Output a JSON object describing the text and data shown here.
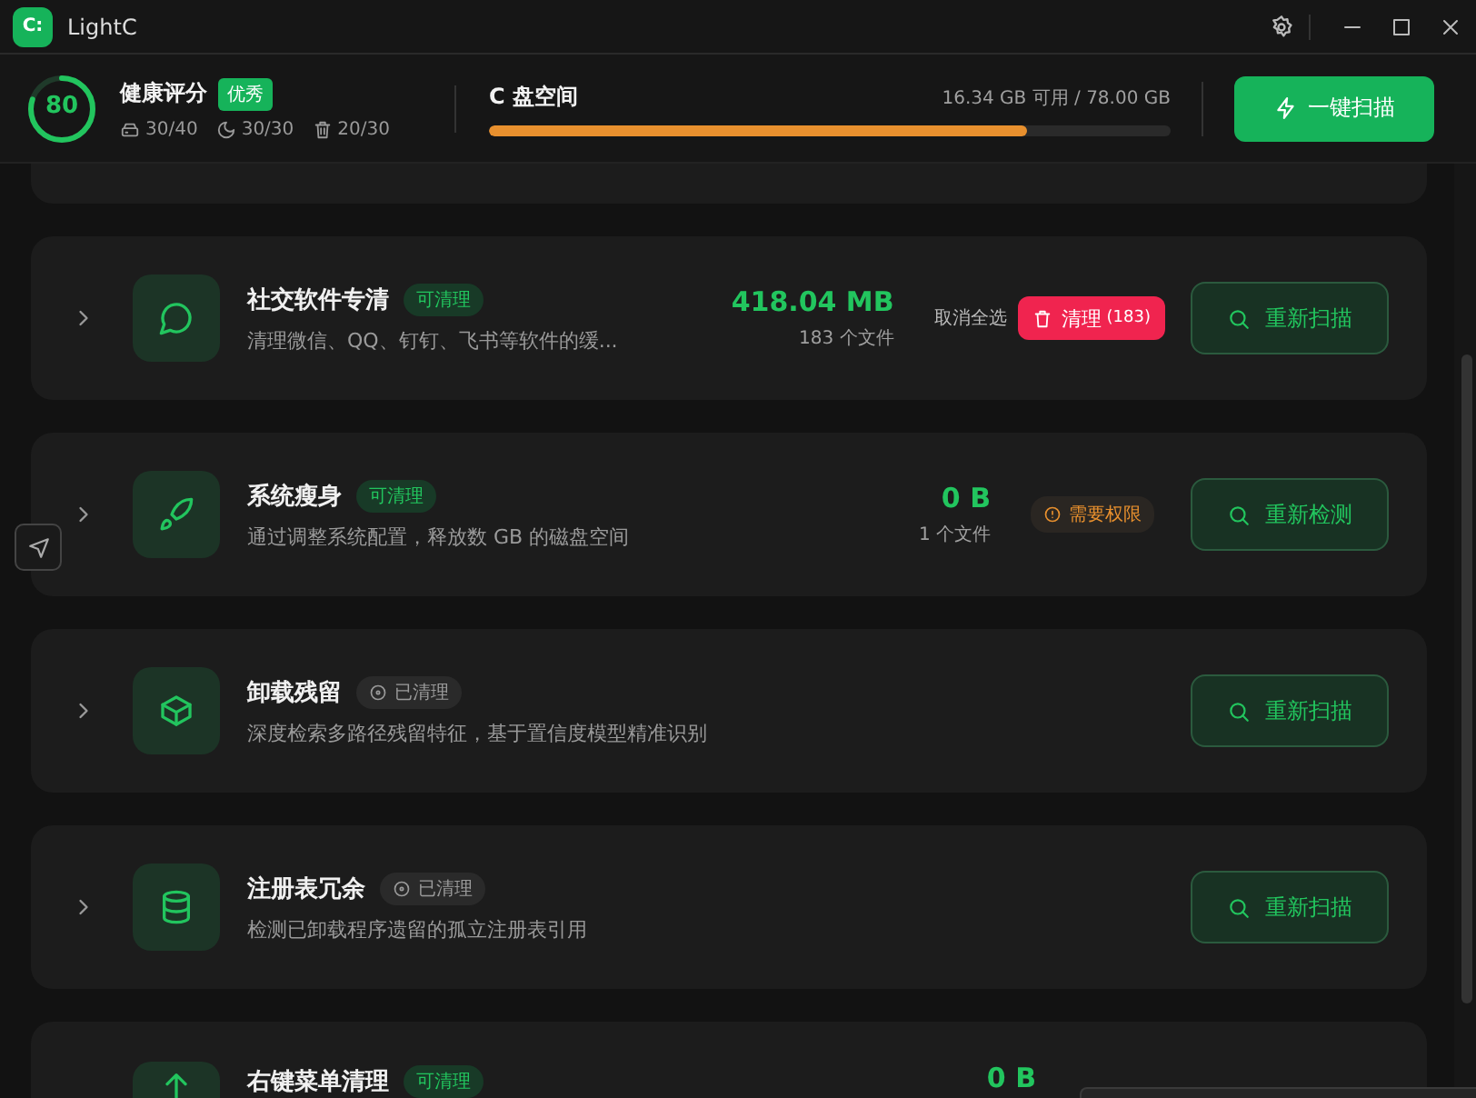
{
  "window": {
    "logo": "C:",
    "title": "LightC"
  },
  "header": {
    "health": {
      "score": "80",
      "level": 0.8,
      "title": "健康评分",
      "grade": "优秀",
      "stats": [
        {
          "kind": "disk",
          "value": "30/40"
        },
        {
          "kind": "moon",
          "value": "30/30"
        },
        {
          "kind": "trash",
          "value": "20/30"
        }
      ]
    },
    "disk": {
      "title": "C 盘空间",
      "info": "16.34 GB 可用 / 78.00 GB",
      "level": 0.79
    },
    "scan_button": "一键扫描"
  },
  "cards": [
    {
      "expanded": false,
      "title": "社交软件专清",
      "status": {
        "kind": "cleanable",
        "label": "可清理"
      },
      "description": "清理微信、QQ、钉钉、飞书等软件的缓...",
      "size": "418.04 MB",
      "files": "183 个文件",
      "deselect": "取消全选",
      "clean": {
        "label": "清理",
        "count": "(183)"
      },
      "action": "重新扫描"
    },
    {
      "expanded": false,
      "title": "系统瘦身",
      "status": {
        "kind": "cleanable",
        "label": "可清理"
      },
      "description": "通过调整系统配置，释放数 GB 的磁盘空间",
      "size": "0 B",
      "files": "1 个文件",
      "notice": {
        "kind": "permission",
        "label": "需要权限"
      },
      "action": "重新检测"
    },
    {
      "expanded": false,
      "title": "卸载残留",
      "status": {
        "kind": "cleaned",
        "label": "已清理"
      },
      "description": "深度检索多路径残留特征，基于置信度模型精准识别",
      "action": "重新扫描"
    },
    {
      "expanded": false,
      "title": "注册表冗余",
      "status": {
        "kind": "cleaned",
        "label": "已清理"
      },
      "description": "检测已卸载程序遗留的孤立注册表引用",
      "action": "重新扫描"
    },
    {
      "title": "右键菜单清理",
      "status": {
        "kind": "cleanable",
        "label": "可清理"
      },
      "size": "0 B"
    }
  ]
}
